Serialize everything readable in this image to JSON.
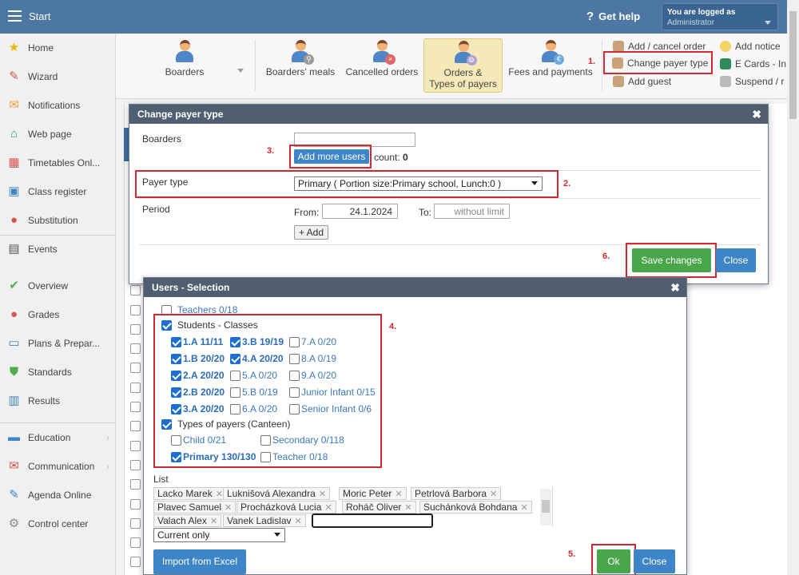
{
  "topbar": {
    "title": "Start",
    "help": "Get help",
    "logged_line1": "You are logged as",
    "logged_line2": "Administrator"
  },
  "sidebar": {
    "items": [
      {
        "label": "Home",
        "icon": "star-icon",
        "color": "#f0b400"
      },
      {
        "label": "Wizard",
        "icon": "wand-icon",
        "color": "#d9534f"
      },
      {
        "label": "Notifications",
        "icon": "envelope-icon",
        "color": "#f0a030"
      },
      {
        "label": "Web page",
        "icon": "house-icon",
        "color": "#2e9e6a"
      },
      {
        "label": "Timetables Onl...",
        "icon": "calendar-icon",
        "color": "#d9534f"
      },
      {
        "label": "Class register",
        "icon": "register-icon",
        "color": "#3d85c6"
      },
      {
        "label": "Substitution",
        "icon": "person-icon",
        "color": "#d9534f"
      },
      {
        "label": "Events",
        "icon": "events-icon",
        "color": "#555555"
      },
      {
        "label": "Overview",
        "icon": "check-circle-icon",
        "color": "#4cae4c"
      },
      {
        "label": "Grades",
        "icon": "grades-icon",
        "color": "#d9534f"
      },
      {
        "label": "Plans & Prepar...",
        "icon": "plans-icon",
        "color": "#3d85c6"
      },
      {
        "label": "Standards",
        "icon": "shield-icon",
        "color": "#4cae4c"
      },
      {
        "label": "Results",
        "icon": "bar-chart-icon",
        "color": "#3d85c6"
      },
      {
        "label": "Education",
        "icon": "book-icon",
        "color": "#3d85c6"
      },
      {
        "label": "Communication",
        "icon": "chat-icon",
        "color": "#d9534f"
      },
      {
        "label": "Agenda Online",
        "icon": "pen-icon",
        "color": "#3d85c6"
      },
      {
        "label": "Control center",
        "icon": "gear-icon",
        "color": "#888888"
      }
    ]
  },
  "toolbar": {
    "buttons": [
      "Boarders",
      "Boarders' meals",
      "Cancelled orders",
      "Orders &",
      "Types of payers",
      "Fees and payments"
    ],
    "side_actions": [
      "Add / cancel order",
      "Change payer type",
      "Add guest",
      "Add notice",
      "E Cards - In",
      "Suspend / r"
    ]
  },
  "dialog": {
    "title": "Change payer type",
    "boarders_label": "Boarders",
    "add_more": "Add more users",
    "count_label": "count:",
    "count_value": "0",
    "payer_type_label": "Payer type",
    "payer_type_value": "Primary ( Portion size:Primary school, Lunch:0 )",
    "period_label": "Period",
    "from_label": "From:",
    "from_value": "24.1.2024",
    "to_label": "To:",
    "to_placeholder": "without limit",
    "add_button": "+ Add",
    "save": "Save changes",
    "close": "Close"
  },
  "selection": {
    "title": "Users - Selection",
    "teachers": "Teachers 0/18",
    "students_group": "Students - Classes",
    "classes": [
      "1.A 11/11",
      "3.B 19/19",
      "7.A 0/20",
      "1.B 20/20",
      "4.A 20/20",
      "8.A 0/19",
      "2.A 20/20",
      "5.A 0/20",
      "9.A 0/20",
      "2.B 20/20",
      "5.B 0/19",
      "Junior Infant 0/15",
      "3.A 20/20",
      "6.A 0/20",
      "Senior Infant 0/6"
    ],
    "payers_group": "Types of payers (Canteen)",
    "payers": [
      "Child 0/21",
      "Secondary 0/118",
      "Primary 130/130",
      "Teacher 0/18"
    ],
    "list_label": "List",
    "list_names": [
      "Lacko Marek",
      "Luknišová Alexandra",
      "Moric Peter",
      "Petrlová Barbora",
      "Plavec Samuel",
      "Procházková Lucia",
      "Roháč Oliver",
      "Suchánková Bohdana",
      "Valach Alex",
      "Vanek Ladislav"
    ],
    "filter_value": "Current only",
    "import": "Import from Excel",
    "ok": "Ok",
    "close": "Close"
  },
  "steps": [
    "1.",
    "2.",
    "3.",
    "4.",
    "5.",
    "6."
  ],
  "colors": {
    "topbar": "#4c77a3",
    "primary": "#3d85c6",
    "green": "#4aa64a",
    "highlight": "#d6282f"
  }
}
